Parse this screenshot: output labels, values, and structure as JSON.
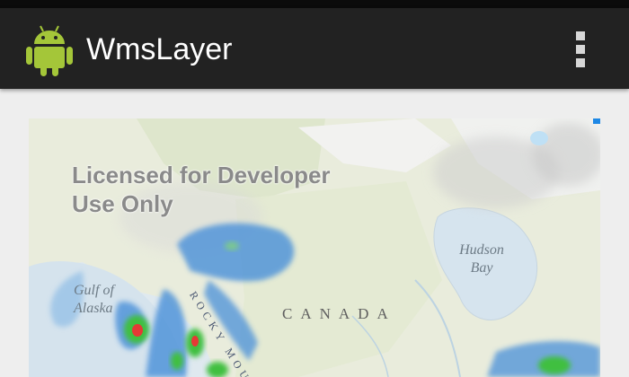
{
  "app": {
    "title": "WmsLayer",
    "icon": "android-robot-icon",
    "menu_icon": "overflow-menu-icon"
  },
  "map": {
    "watermark": "Licensed for Developer Use Only",
    "labels": {
      "gulf_of_alaska": "Gulf of Alaska",
      "hudson_bay": "Hudson Bay",
      "canada": "CANADA",
      "rocky_mountains": "ROCKY MOU"
    }
  },
  "colors": {
    "action_bar": "#222222",
    "status_bar": "#0b0b0b",
    "android_green": "#a4c639",
    "radar_blue": "#4a90d9",
    "radar_green": "#3fbf3f",
    "radar_red": "#e53935"
  }
}
